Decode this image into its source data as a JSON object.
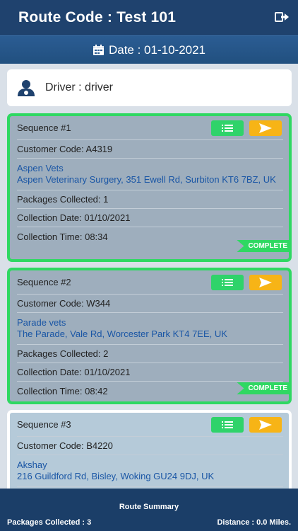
{
  "header": {
    "title": "Route Code : Test 101",
    "logout_icon": "logout-icon"
  },
  "datebar": {
    "label": "Date : 01-10-2021",
    "icon": "calendar-icon"
  },
  "driver": {
    "label": "Driver : driver",
    "icon": "driver-icon"
  },
  "sequences": [
    {
      "title": "Sequence #1",
      "customer_code": "Customer Code: A4319",
      "name": "Aspen Vets",
      "address": "Aspen Veterinary Surgery, 351 Ewell Rd, Surbiton KT6 7BZ, UK",
      "packages": "Packages Collected: 1",
      "date": "Collection Date: 01/10/2021",
      "time": "Collection Time: 08:34",
      "status": "COMPLETE"
    },
    {
      "title": "Sequence #2",
      "customer_code": "Customer Code: W344",
      "name": "Parade vets",
      "address": "The Parade, Vale Rd, Worcester Park KT4 7EE, UK",
      "packages": "Packages Collected: 2",
      "date": "Collection Date: 01/10/2021",
      "time": "Collection Time: 08:42",
      "status": "COMPLETE"
    },
    {
      "title": "Sequence #3",
      "customer_code": "Customer Code: B4220",
      "name": "Akshay",
      "address": "216 Guildford Rd, Bisley, Woking GU24 9DJ, UK"
    }
  ],
  "footer": {
    "title": "Route Summary",
    "packages": "Packages Collected : 3",
    "distance": "Distance : 0.0 Miles."
  },
  "colors": {
    "header": "#1f426e",
    "complete_green": "#2fd862",
    "nav_button": "#f7b416",
    "list_button": "#2fd36a",
    "link_blue": "#1a56a5"
  }
}
